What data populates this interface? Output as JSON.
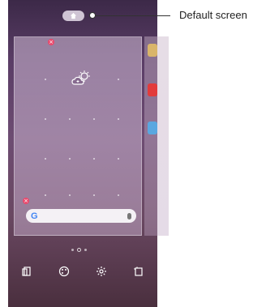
{
  "callout": {
    "label": "Default screen"
  },
  "search": {
    "logo": "G"
  },
  "icons": {
    "home": "home-icon",
    "weather": "weather-icon",
    "widgets": "widgets-icon",
    "wallpaper": "wallpaper-icon",
    "settings": "gear-icon",
    "apps": "apps-icon",
    "mic": "mic-icon",
    "remove": "close-icon"
  },
  "colors": {
    "accent": "#e94a6d",
    "background": "#5a3d66"
  }
}
